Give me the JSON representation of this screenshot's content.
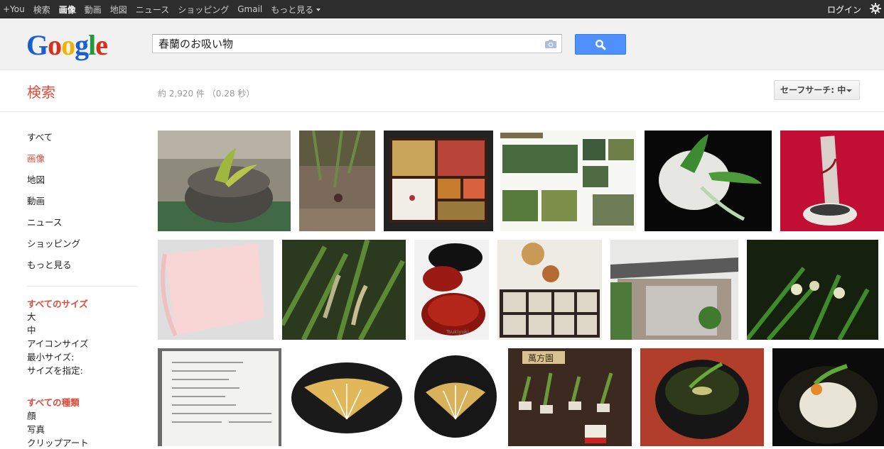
{
  "topbar": {
    "nav": [
      {
        "label": "+You",
        "active": false
      },
      {
        "label": "検索",
        "active": false
      },
      {
        "label": "画像",
        "active": true
      },
      {
        "label": "動画",
        "active": false
      },
      {
        "label": "地図",
        "active": false
      },
      {
        "label": "ニュース",
        "active": false
      },
      {
        "label": "ショッピング",
        "active": false
      },
      {
        "label": "Gmail",
        "active": false
      },
      {
        "label": "もっと見る",
        "active": false
      }
    ],
    "login": "ログイン"
  },
  "logo": {
    "text": "Google"
  },
  "search": {
    "query": "春蘭のお吸い物"
  },
  "subhead": {
    "title": "検索",
    "stats": "約 2,920 件 （0.28 秒）",
    "safe_search": "セーフサーチ: 中"
  },
  "leftnav": {
    "items": [
      {
        "label": "すべて",
        "active": false
      },
      {
        "label": "画像",
        "active": true
      },
      {
        "label": "地図",
        "active": false
      },
      {
        "label": "動画",
        "active": false
      },
      {
        "label": "ニュース",
        "active": false
      },
      {
        "label": "ショッピング",
        "active": false
      },
      {
        "label": "もっと見る",
        "active": false
      }
    ],
    "size_header": "すべてのサイズ",
    "sizes": [
      "大",
      "中",
      "アイコンサイズ",
      "最小サイズ:",
      "サイズを指定:"
    ],
    "type_header": "すべての種類",
    "types": [
      "顔",
      "写真",
      "クリップアート"
    ]
  },
  "image_thumbs": {
    "dark_labels": [
      "萬方園",
      "Tsukiyuki"
    ]
  },
  "colors": {
    "accent": "#dd4b39",
    "search_button": "#4d90fe",
    "topbar": "#2d2d2d"
  }
}
